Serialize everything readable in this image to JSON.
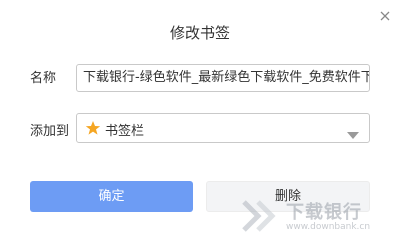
{
  "dialog": {
    "title": "修改书签",
    "close_icon": "close-icon"
  },
  "form": {
    "name_label": "名称",
    "name_value": "下载银行-绿色软件_最新绿色下载软件_免费软件下载",
    "folder_label": "添加到",
    "folder_value": "书签栏",
    "folder_icon": "star-icon",
    "folder_icon_color": "#f5a623"
  },
  "buttons": {
    "confirm": "确定",
    "delete": "删除",
    "confirm_color": "#6d9cf4"
  },
  "watermark": {
    "name": "下载银行",
    "url": "www.downbank.cn"
  }
}
